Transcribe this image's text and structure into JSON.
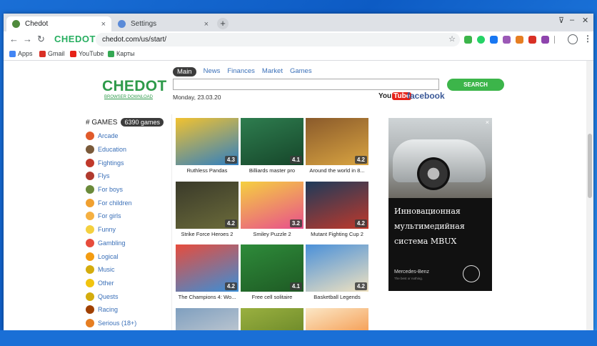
{
  "browser": {
    "tabs": [
      {
        "title": "Chedot",
        "active": true,
        "favicon_color": "#4f8a3c"
      },
      {
        "title": "Settings",
        "active": false,
        "favicon_color": "#5b8bd8"
      }
    ],
    "close_glyph": "×",
    "new_tab_glyph": "+",
    "window_controls": [
      "⊽",
      "–",
      "✕"
    ],
    "nav": {
      "back": "←",
      "forward": "→",
      "reload": "↻"
    },
    "toolbar_logo": "CHEDOT",
    "url": "chedot.com/us/start/",
    "star_glyph": "☆",
    "menu_glyph": "⋮",
    "extensions": [
      "#3cb54a",
      "#1877f2",
      "#25d366",
      "#9b59b6",
      "#e67e22",
      "#d93025",
      "#8e44ad",
      "#a0a0a0"
    ]
  },
  "bookmarks": [
    {
      "label": "Apps",
      "color": "#4285f4"
    },
    {
      "label": "Gmail",
      "color": "#d93025"
    },
    {
      "label": "YouTube",
      "color": "#e62117"
    },
    {
      "label": "Карты",
      "color": "#34a853"
    }
  ],
  "page": {
    "brand": "CHEDOT",
    "brand_download": "BROWSER DOWNLOAD",
    "search_tabs": [
      "Main",
      "News",
      "Finances",
      "Market",
      "Games"
    ],
    "search_button": "SEARCH",
    "date": "Monday, 23.03.20",
    "youtube_prefix": "You",
    "youtube_suffix": "Tube",
    "facebook": "facebook",
    "games_heading": "# GAMES",
    "games_count": "6390 games",
    "categories": [
      {
        "label": "Arcade",
        "color": "#e05a2b"
      },
      {
        "label": "Education",
        "color": "#7a5a3a"
      },
      {
        "label": "Fightings",
        "color": "#c0392b"
      },
      {
        "label": "Flys",
        "color": "#b03a2e"
      },
      {
        "label": "For boys",
        "color": "#6a8a3a"
      },
      {
        "label": "For children",
        "color": "#f0a030"
      },
      {
        "label": "For girls",
        "color": "#f5b041"
      },
      {
        "label": "Funny",
        "color": "#f4d03f"
      },
      {
        "label": "Gambling",
        "color": "#e74c3c"
      },
      {
        "label": "Logical",
        "color": "#f39c12"
      },
      {
        "label": "Music",
        "color": "#d4ac0d"
      },
      {
        "label": "Other",
        "color": "#f1c40f"
      },
      {
        "label": "Quests",
        "color": "#d4ac0d"
      },
      {
        "label": "Racing",
        "color": "#a04000"
      },
      {
        "label": "Serious (18+)",
        "color": "#e67e22"
      }
    ],
    "games": [
      {
        "name": "Ruthless Pandas",
        "rating": "4.3",
        "c1": "#f2c230",
        "c2": "#2f7fc1"
      },
      {
        "name": "Billiards master pro",
        "rating": "4.1",
        "c1": "#2e7d4f",
        "c2": "#16462a"
      },
      {
        "name": "Around the world in 8...",
        "rating": "4.2",
        "c1": "#8a5a2b",
        "c2": "#d9a441"
      },
      {
        "name": "Strike Force Heroes 2",
        "rating": "4.2",
        "c1": "#3a3a2a",
        "c2": "#6b6b3a"
      },
      {
        "name": "Smiley Puzzle 2",
        "rating": "3.2",
        "c1": "#f5d040",
        "c2": "#e84f8c"
      },
      {
        "name": "Mutant Fighting Cup 2",
        "rating": "4.2",
        "c1": "#1d3a5a",
        "c2": "#c0392b"
      },
      {
        "name": "The Champions 4: Wo...",
        "rating": "4.2",
        "c1": "#e74c3c",
        "c2": "#3a8fd8"
      },
      {
        "name": "Free cell solitaire",
        "rating": "4.1",
        "c1": "#2e8b3a",
        "c2": "#1e5a24"
      },
      {
        "name": "Basketball Legends",
        "rating": "4.2",
        "c1": "#4a90d9",
        "c2": "#f0e2c0"
      },
      {
        "name": "",
        "rating": "",
        "c1": "#7f9fbf",
        "c2": "#d8d8d8"
      },
      {
        "name": "",
        "rating": "",
        "c1": "#9ab040",
        "c2": "#5a7a20"
      },
      {
        "name": "",
        "rating": "",
        "c1": "#fbe7c6",
        "c2": "#f27c20"
      }
    ],
    "ad": {
      "close": "×",
      "lines": [
        "Инновационная",
        "мультимедийная",
        "система MBUX"
      ],
      "brand": "Mercedes-Benz",
      "tagline": "The best or nothing."
    }
  }
}
